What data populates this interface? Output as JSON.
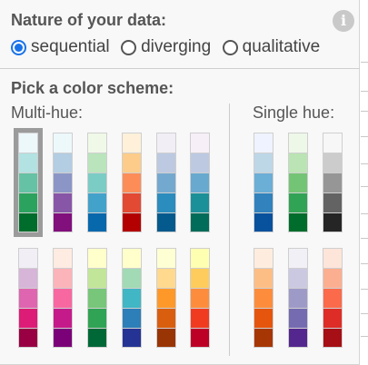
{
  "nature": {
    "title": "Nature of your data:",
    "info_icon": "info-icon",
    "options": [
      {
        "label": "sequential",
        "checked": true
      },
      {
        "label": "diverging",
        "checked": false
      },
      {
        "label": "qualitative",
        "checked": false
      }
    ]
  },
  "pick": {
    "title": "Pick a color scheme:",
    "multi_hue_label": "Multi-hue:",
    "single_hue_label": "Single hue:"
  },
  "colors": {
    "accent": "#1a73e8",
    "selected_outline": "#9b9b9b"
  },
  "schemes": {
    "multi_hue_row1": [
      {
        "selected": true,
        "colors": [
          "#edf8fb",
          "#b2e2e2",
          "#66c2a4",
          "#2ca25f",
          "#006d2c"
        ]
      },
      {
        "selected": false,
        "colors": [
          "#edf8fb",
          "#b3cde3",
          "#8c96c6",
          "#8856a7",
          "#810f7c"
        ]
      },
      {
        "selected": false,
        "colors": [
          "#f0f9e8",
          "#bae4bc",
          "#7bccc4",
          "#43a2ca",
          "#0868ac"
        ]
      },
      {
        "selected": false,
        "colors": [
          "#fef0d9",
          "#fdcc8a",
          "#fc8d59",
          "#e34a33",
          "#b30000"
        ]
      },
      {
        "selected": false,
        "colors": [
          "#f1eef6",
          "#bdc9e1",
          "#74a9cf",
          "#2b8cbe",
          "#045a8d"
        ]
      },
      {
        "selected": false,
        "colors": [
          "#f6eff7",
          "#bdc9e1",
          "#67a9cf",
          "#1c9099",
          "#016c59"
        ]
      }
    ],
    "multi_hue_row2": [
      {
        "selected": false,
        "colors": [
          "#f1eef6",
          "#d7b5d8",
          "#df65b0",
          "#dd1c77",
          "#980043"
        ]
      },
      {
        "selected": false,
        "colors": [
          "#feebe2",
          "#fbb4b9",
          "#f768a1",
          "#c51b8a",
          "#7a0177"
        ]
      },
      {
        "selected": false,
        "colors": [
          "#ffffcc",
          "#c2e699",
          "#78c679",
          "#31a354",
          "#006837"
        ]
      },
      {
        "selected": false,
        "colors": [
          "#ffffcc",
          "#a1dab4",
          "#41b6c4",
          "#2c7fb8",
          "#253494"
        ]
      },
      {
        "selected": false,
        "colors": [
          "#ffffd4",
          "#fed98e",
          "#fe9929",
          "#d95f0e",
          "#993404"
        ]
      },
      {
        "selected": false,
        "colors": [
          "#ffffb2",
          "#fecc5c",
          "#fd8d3c",
          "#f03b20",
          "#bd0026"
        ]
      }
    ],
    "single_hue_row1": [
      {
        "selected": false,
        "colors": [
          "#eff3ff",
          "#bdd7e7",
          "#6baed6",
          "#3182bd",
          "#08519c"
        ]
      },
      {
        "selected": false,
        "colors": [
          "#edf8e9",
          "#bae4b3",
          "#74c476",
          "#31a354",
          "#006d2c"
        ]
      },
      {
        "selected": false,
        "colors": [
          "#f7f7f7",
          "#cccccc",
          "#969696",
          "#636363",
          "#252525"
        ]
      }
    ],
    "single_hue_row2": [
      {
        "selected": false,
        "colors": [
          "#feedde",
          "#fdbe85",
          "#fd8d3c",
          "#e6550d",
          "#a63603"
        ]
      },
      {
        "selected": false,
        "colors": [
          "#f2f0f7",
          "#cbc9e2",
          "#9e9ac8",
          "#756bb1",
          "#54278f"
        ]
      },
      {
        "selected": false,
        "colors": [
          "#fee5d9",
          "#fcae91",
          "#fb6a4a",
          "#de2d26",
          "#a50f15"
        ]
      }
    ]
  }
}
